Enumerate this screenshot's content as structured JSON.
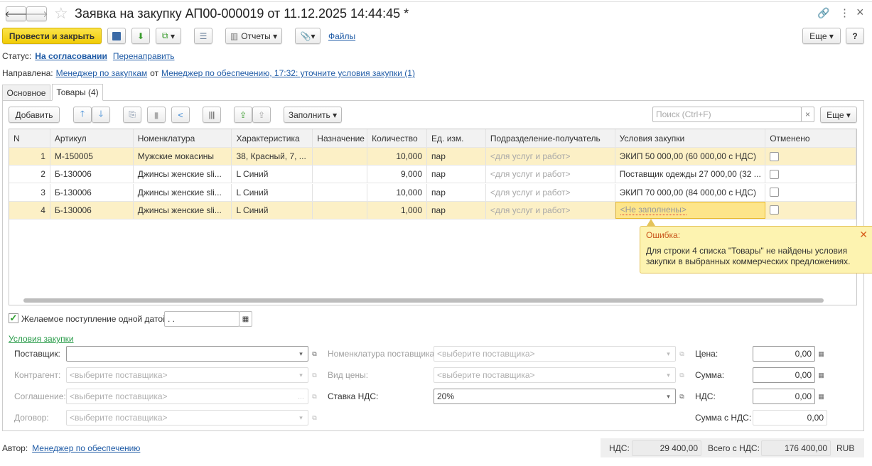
{
  "window": {
    "title": "Заявка на закупку АП00-000019 от 11.12.2025 14:44:45 *"
  },
  "toolbar": {
    "post_close": "Провести и закрыть",
    "reports": "Отчеты",
    "files": "Файлы",
    "more": "Еще",
    "help": "?"
  },
  "status": {
    "label": "Статус:",
    "value": "На согласовании",
    "redirect": "Перенаправить"
  },
  "routed": {
    "label": "Направлена:",
    "to": "Менеджер по закупкам",
    "from_label": "от",
    "from": "Менеджер по обеспечению, 17:32: уточните условия закупки (1)"
  },
  "tabs": [
    {
      "label": "Основное"
    },
    {
      "label": "Товары (4)"
    }
  ],
  "table_toolbar": {
    "add": "Добавить",
    "fill": "Заполнить",
    "search_placeholder": "Поиск (Ctrl+F)",
    "clear": "×",
    "more": "Еще"
  },
  "table": {
    "headers": [
      "N",
      "Артикул",
      "Номенклатура",
      "Характеристика",
      "Назначение",
      "Количество",
      "Ед. изм.",
      "Подразделение-получатель",
      "Условия закупки",
      "Отменено"
    ],
    "rows": [
      {
        "n": "1",
        "sku": "М-150005",
        "item": "Мужские мокасины",
        "char": "38, Красный, 7, ...",
        "purpose": "",
        "qty": "10,000",
        "unit": "пар",
        "dept": "<для услуг и работ>",
        "terms": "ЭКИП 50 000,00 (60 000,00 с НДС)",
        "cancelled": false
      },
      {
        "n": "2",
        "sku": "Б-130006",
        "item": "Джинсы женские sli...",
        "char": "L Синий",
        "purpose": "",
        "qty": "9,000",
        "unit": "пар",
        "dept": "<для услуг и работ>",
        "terms": "Поставщик одежды 27 000,00 (32 ...",
        "cancelled": false
      },
      {
        "n": "3",
        "sku": "Б-130006",
        "item": "Джинсы женские sli...",
        "char": "L Синий",
        "purpose": "",
        "qty": "10,000",
        "unit": "пар",
        "dept": "<для услуг и работ>",
        "terms": "ЭКИП 70 000,00 (84 000,00 с НДС)",
        "cancelled": false
      },
      {
        "n": "4",
        "sku": "Б-130006",
        "item": "Джинсы женские sli...",
        "char": "L Синий",
        "purpose": "",
        "qty": "1,000",
        "unit": "пар",
        "dept": "<для услуг и работ>",
        "terms": "<Не заполнены>",
        "cancelled": false
      }
    ]
  },
  "error": {
    "title": "Ошибка:",
    "text": "Для строки 4 списка \"Товары\" не найдены условия закупки в выбранных коммерческих предложениях."
  },
  "single_date": {
    "label": "Желаемое поступление одной датой",
    "checked": true,
    "value": " .  ."
  },
  "terms": {
    "title": "Условия закупки",
    "supplier": {
      "label": "Поставщик:",
      "value": ""
    },
    "contractor": {
      "label": "Контрагент:",
      "placeholder": "<выберите поставщика>"
    },
    "agreement": {
      "label": "Соглашение:",
      "placeholder": "<выберите поставщика>"
    },
    "contract": {
      "label": "Договор:",
      "placeholder": "<выберите поставщика>"
    },
    "supplier_item": {
      "label": "Номенклатура поставщика:",
      "placeholder": "<выберите поставщика>"
    },
    "price_type": {
      "label": "Вид цены:",
      "placeholder": "<выберите поставщика>"
    },
    "vat_rate": {
      "label": "Ставка НДС:",
      "value": "20%"
    },
    "price": {
      "label": "Цена:",
      "value": "0,00"
    },
    "sum": {
      "label": "Сумма:",
      "value": "0,00"
    },
    "vat": {
      "label": "НДС:",
      "value": "0,00"
    },
    "sum_vat": {
      "label": "Сумма с НДС:",
      "value": "0,00"
    }
  },
  "footer": {
    "author_label": "Автор:",
    "author": "Менеджер по обеспечению",
    "vat_label": "НДС:",
    "vat": "29 400,00",
    "total_label": "Всего с НДС:",
    "total": "176 400,00",
    "currency": "RUB"
  },
  "colors": {
    "accent": "#f5d50e",
    "link": "#1f5ba6",
    "highlight": "#fcf0c6",
    "error": "#fdf3b0"
  }
}
